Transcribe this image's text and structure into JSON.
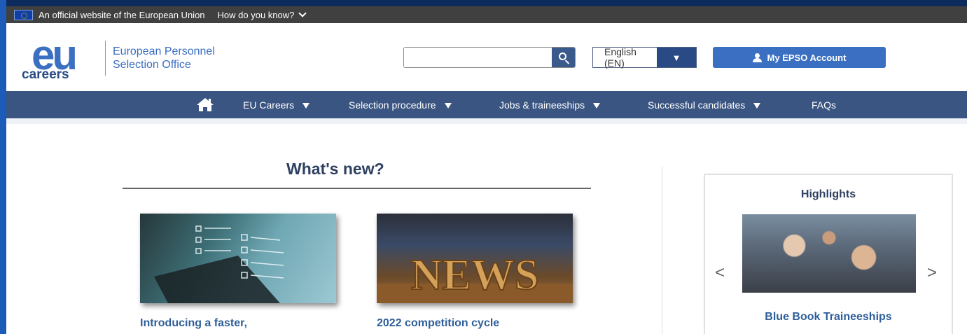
{
  "eu_bar": {
    "official_text": "An official website of the European Union",
    "how_text": "How do you know?"
  },
  "header": {
    "logo_eu": "eu",
    "logo_careers": "careers",
    "org_line1": "European Personnel",
    "org_line2": "Selection Office",
    "search_value": "",
    "language": "English (EN)",
    "account_label": "My EPSO Account"
  },
  "nav": {
    "items": [
      {
        "label": "EU Careers",
        "dropdown": true
      },
      {
        "label": "Selection procedure",
        "dropdown": true
      },
      {
        "label": "Jobs & traineeships",
        "dropdown": true
      },
      {
        "label": "Successful candidates",
        "dropdown": true
      },
      {
        "label": "FAQs",
        "dropdown": false
      }
    ]
  },
  "whats_new": {
    "title": "What's new?",
    "cards": [
      {
        "title": "Introducing a faster,"
      },
      {
        "title": "2022 competition cycle",
        "image_text": "NEWS"
      }
    ]
  },
  "highlights": {
    "title": "Highlights",
    "prev": "<",
    "next": ">",
    "caption": "Blue Book Traineeships"
  },
  "colors": {
    "nav_bg": "#3a5582",
    "accent": "#3a6fc2",
    "eu_bar_bg": "#404040",
    "heading": "#2f4161"
  }
}
